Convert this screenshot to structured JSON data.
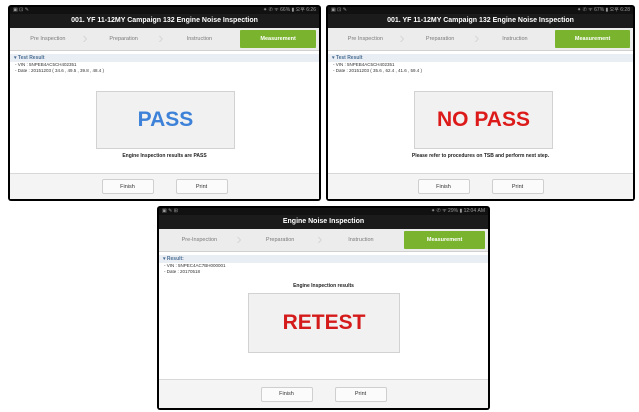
{
  "panels": [
    {
      "status_left": "▣ ⊡ ✎",
      "status_right": "⁕ ✆ ᯤ 66% ▮ 오후 6:26",
      "title": "001. YF 11-12MY Campaign 132 Engine Noise Inspection",
      "steps": [
        "Pre Inspection",
        "Preparation",
        "Instruction",
        "Measurement"
      ],
      "result_header": "▾ Test Result",
      "vin": "- VIN : 5NPEB4AC5CH402351",
      "date": "- Date : 20151203 ( 34.6 , 49.5 , 39.8 , 48.4 )",
      "verdict": "PASS",
      "verdict_color": "#3d82d8",
      "note": "Engine Inspection results are PASS",
      "finish": "Finish",
      "print": "Print"
    },
    {
      "status_left": "▣ ⊡ ✎",
      "status_right": "⁕ ✆ ᯤ 67% ▮ 오후 6:28",
      "title": "001. YF 11-12MY Campaign 132 Engine Noise Inspection",
      "steps": [
        "Pre Inspection",
        "Preparation",
        "Instruction",
        "Measurement"
      ],
      "result_header": "▾ Test Result",
      "vin": "- VIN : 5NPEB4AC5CH402351",
      "date": "- Date : 20151203 ( 35.6 , 62.4 , 41.6 , 59.4 )",
      "verdict": "NO PASS",
      "verdict_color": "#dd1a1a",
      "note": "Please refer to procedures on TSB and perform next step.",
      "finish": "Finish",
      "print": "Print"
    },
    {
      "status_left": "▣ ✎ ⊞",
      "status_right": "⁕ ✆ ᯤ 29% ▮ 12:04 AM",
      "title": "Engine Noise Inspection",
      "steps": [
        "Pre-Inspection",
        "Preparation",
        "Instruction",
        "Measurement"
      ],
      "result_header": "▾ Result:",
      "vin": "- VIN : 5NPEC4AC7BH000001",
      "date": "- Date : 20170518",
      "results_label": "Engine Inspection results",
      "verdict": "RETEST",
      "verdict_color": "#d41a1a",
      "finish": "Finish",
      "print": "Print"
    }
  ]
}
